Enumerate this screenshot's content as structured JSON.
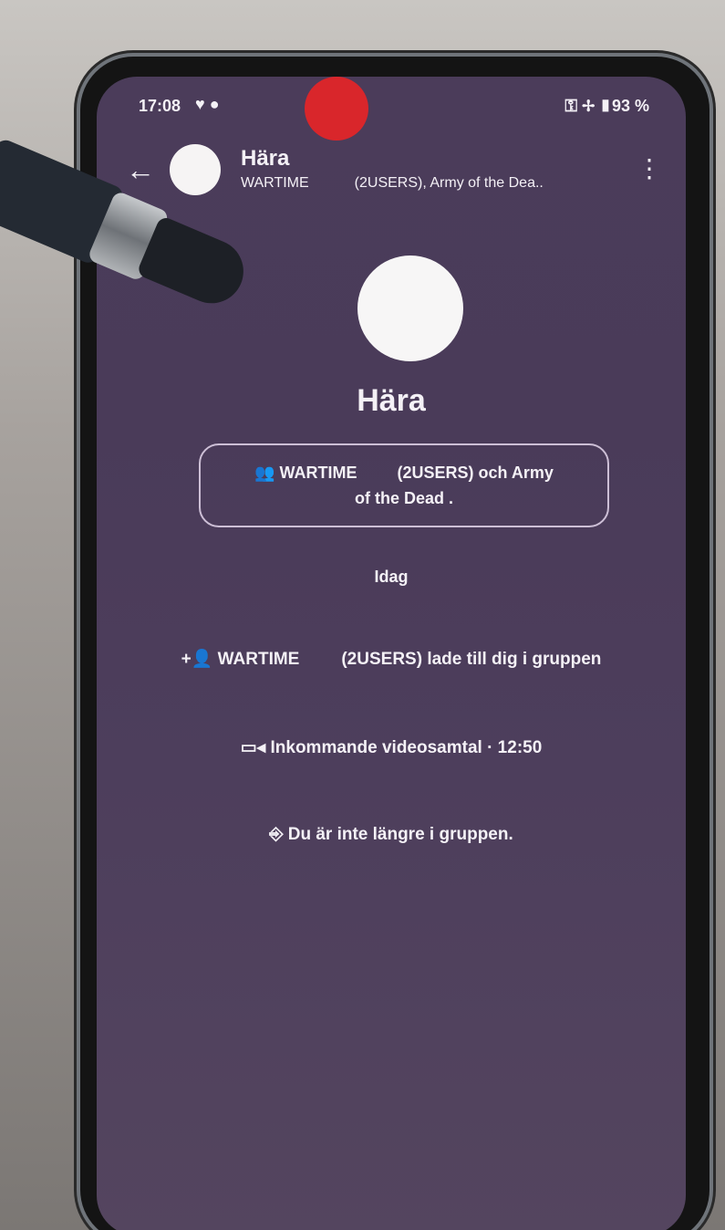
{
  "status_bar": {
    "time": "17:08",
    "left_icons": "♥ ●",
    "right_status": "⚿ ✢ ▮93 %"
  },
  "header": {
    "back_icon": "←",
    "title": "Härа",
    "subtitle_part1": "WARTIME",
    "subtitle_part2": "(2USERS), Army of the Dea..",
    "more_icon": "⋮"
  },
  "profile": {
    "name": "Hära"
  },
  "members": {
    "icon": "👥",
    "part1": "WARTIME",
    "part2": "(2USERS) och Army",
    "line2": "of the Dead ."
  },
  "date_separator": "Idag",
  "events": {
    "added_icon": "+👤",
    "added_part1": "WARTIME",
    "added_part2": "(2USERS) lade till dig i gruppen",
    "video_icon": "▭◂",
    "video_text": "Inkommande videosamtal · 12:50",
    "left_icon": "⎆",
    "left_text": "Du är inte längre i gruppen."
  },
  "colors": {
    "screen_bg": "#4b3c5a",
    "record_dot": "#d9262b"
  }
}
